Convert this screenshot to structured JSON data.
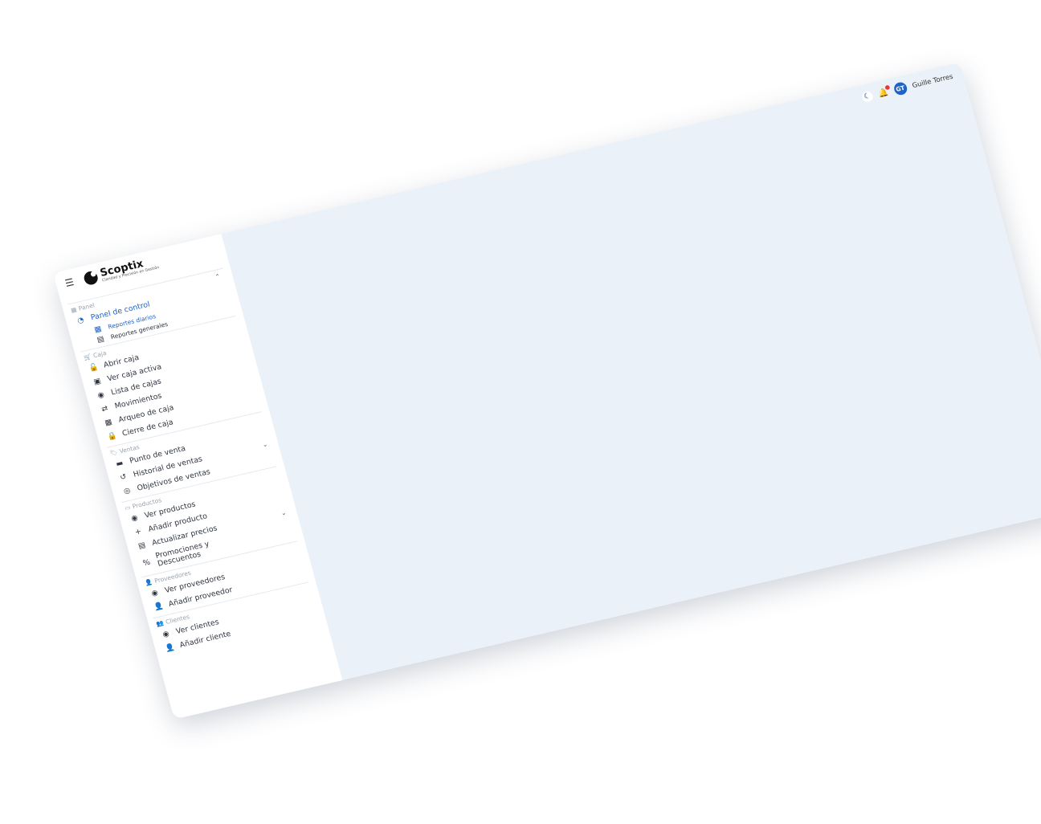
{
  "header": {
    "theme_icon": "moon-icon",
    "notification_icon": "bell-icon",
    "user": {
      "initials": "GT",
      "name": "Guille Torres"
    }
  },
  "brand": {
    "name": "Scoptix",
    "tagline": "Claridad y Precisión en Gestión"
  },
  "sidebar": {
    "sections": [
      {
        "title": "Panel",
        "items": [
          {
            "label": "Panel de control",
            "active": true,
            "icon": "chart-pie-icon"
          },
          {
            "label": "Reportes diarios",
            "active": true,
            "icon": "calendar-icon"
          },
          {
            "label": "Reportes generales",
            "icon": "file-report-icon"
          }
        ]
      },
      {
        "title": "Caja",
        "items": [
          {
            "label": "Abrir caja",
            "icon": "unlock-icon"
          },
          {
            "label": "Ver caja activa",
            "icon": "cash-register-icon"
          },
          {
            "label": "Lista de cajas",
            "icon": "eye-icon"
          },
          {
            "label": "Movimientos",
            "icon": "exchange-icon"
          },
          {
            "label": "Arqueo de caja",
            "icon": "calculator-icon"
          },
          {
            "label": "Cierre de caja",
            "icon": "lock-icon"
          }
        ]
      },
      {
        "title": "Ventas",
        "items": [
          {
            "label": "Punto de venta",
            "icon": "store-icon"
          },
          {
            "label": "Historial de ventas",
            "icon": "history-icon"
          },
          {
            "label": "Objetivos de ventas",
            "icon": "target-icon"
          }
        ]
      },
      {
        "title": "Productos",
        "items": [
          {
            "label": "Ver productos",
            "icon": "eye-icon"
          },
          {
            "label": "Añadir producto",
            "icon": "plus-icon"
          },
          {
            "label": "Actualizar precios",
            "icon": "price-tag-icon"
          },
          {
            "label": "Promociones y Descuentos",
            "icon": "percent-icon"
          }
        ]
      },
      {
        "title": "Proveedores",
        "items": [
          {
            "label": "Ver proveedores",
            "icon": "eye-icon"
          },
          {
            "label": "Añadir proveedor",
            "icon": "user-plus-icon"
          }
        ]
      },
      {
        "title": "Clientes",
        "items": [
          {
            "label": "Ver clientes",
            "icon": "eye-icon"
          },
          {
            "label": "Añadir cliente",
            "icon": "user-plus-icon"
          }
        ]
      }
    ]
  },
  "colors": {
    "accent": "#1e63c9",
    "background": "#ebf1f8",
    "sidebar": "#ffffff"
  }
}
